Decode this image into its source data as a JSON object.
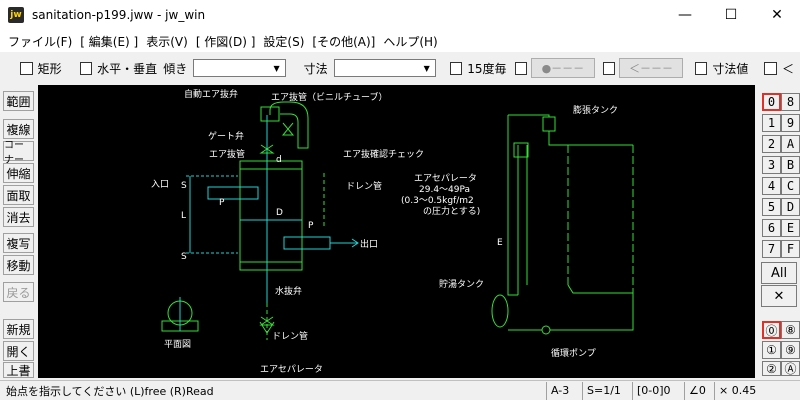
{
  "window": {
    "app_icon": "jw",
    "title": "sanitation-p199.jww - jw_win",
    "controls": {
      "minimize": "—",
      "maximize": "☐",
      "close": "✕"
    }
  },
  "menu": [
    "ファイル(F)",
    "[ 編集(E) ]",
    "表示(V)",
    "[ 作図(D) ]",
    "設定(S)",
    "[その他(A)]",
    "ヘルプ(H)"
  ],
  "toolbar": {
    "rect_label": "矩形",
    "hv_label": "水平・垂直",
    "tilt_label": "傾き",
    "tilt_value": "",
    "dim_label": "寸法",
    "dim_value": "",
    "deg15_label": "15度毎",
    "btn1_label": "●－－－",
    "btn2_label": "＜－－－",
    "dimval_label": "寸法値",
    "last_label": "＜"
  },
  "left_tools": [
    "範囲",
    "複線",
    "コーナー",
    "伸縮",
    "面取",
    "消去",
    "複写",
    "移動",
    "戻る",
    "新規",
    "開く",
    "上書"
  ],
  "right_tools": {
    "layer_col1": [
      "0",
      "1",
      "2",
      "3",
      "4",
      "5",
      "6",
      "7"
    ],
    "layer_col2": [
      "8",
      "9",
      "A",
      "B",
      "C",
      "D",
      "E",
      "F"
    ],
    "all_label": "All",
    "cross_label": "✕",
    "group_col1": [
      "⓪",
      "①",
      "②"
    ],
    "group_col2": [
      "⑧",
      "⑨",
      "Ⓐ"
    ]
  },
  "drawing": {
    "labels": {
      "auto_air": "自動エア抜弁",
      "air_pipe": "エア抜管（ビニルチューブ）",
      "gate": "ゲート弁",
      "air_pipe2": "エア抜管",
      "d": "d",
      "air_check": "エア抜確認チェック",
      "inlet": "入口",
      "drain": "ドレン管",
      "s_top": "S",
      "l": "L",
      "s_bot": "S",
      "d_cap": "D",
      "p1": "P",
      "p2": "P",
      "outlet": "出口",
      "water_valve": "水抜弁",
      "drain2": "ドレン管",
      "plan": "平面図",
      "separator": "エアセパレータ",
      "expansion": "膨張タンク",
      "separator2": "エアセパレータ",
      "pressure1": "29.4～49Pa",
      "pressure2": "(0.3～0.5kgf/m2",
      "pressure3": "の圧力とする)",
      "e": "E",
      "storage": "貯湯タンク",
      "pump": "循環ポンプ"
    }
  },
  "status": {
    "message": "始点を指示してください (L)free (R)Read",
    "paper": "A-3",
    "scale": "S=1/1",
    "layer": "[0-0]0",
    "angle": "∠0",
    "factor": "× 0.45"
  }
}
